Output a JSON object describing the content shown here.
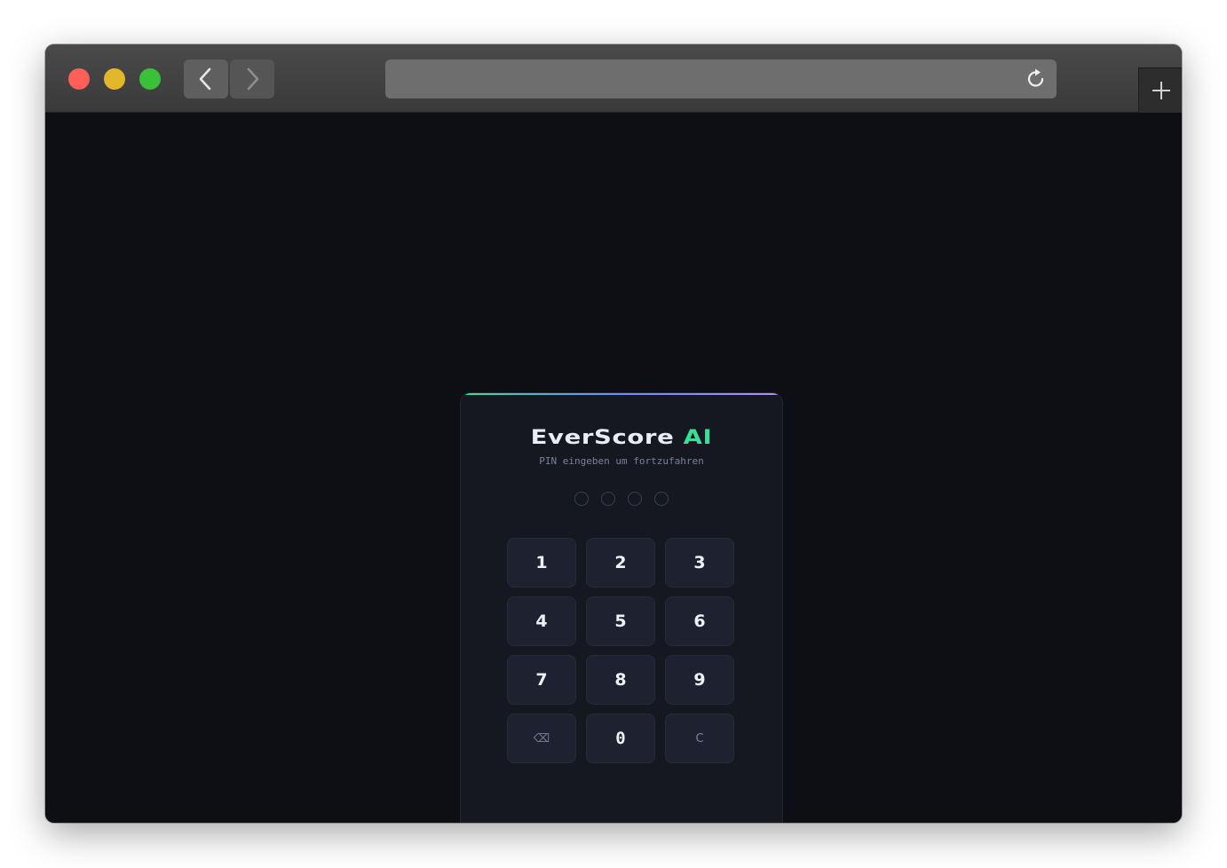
{
  "browser": {
    "url": "",
    "back_icon": "chevron-left-icon",
    "forward_icon": "chevron-right-icon",
    "reload_icon": "reload-icon",
    "new_tab_icon": "plus-icon"
  },
  "login": {
    "brand_main": "EverScore",
    "brand_accent": "AI",
    "subtitle": "PIN eingeben um fortzufahren",
    "pin_length": 4,
    "pin_filled": 0,
    "accent_color": "#3ddc97",
    "keys": {
      "k1": "1",
      "k2": "2",
      "k3": "3",
      "k4": "4",
      "k5": "5",
      "k6": "6",
      "k7": "7",
      "k8": "8",
      "k9": "9",
      "backspace": "⌫",
      "k0": "0",
      "clear": "C"
    }
  }
}
